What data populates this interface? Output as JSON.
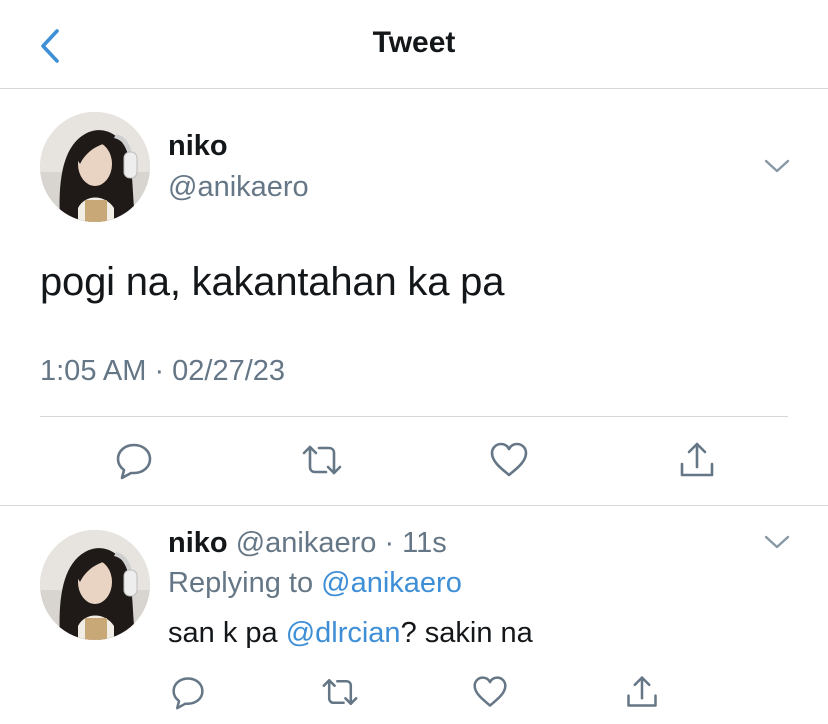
{
  "header": {
    "title": "Tweet",
    "back_icon": "chevron-left-icon",
    "accent": "#3e8fd6"
  },
  "tweet": {
    "name": "niko",
    "handle": "@anikaero",
    "text": "pogi na, kakantahan ka pa",
    "timestamp": "1:05 AM · 02/27/23",
    "menu_icon": "chevron-down-icon",
    "actions": [
      "reply-icon",
      "retweet-icon",
      "like-icon",
      "share-icon"
    ]
  },
  "reply": {
    "name": "niko",
    "handle": "@anikaero",
    "separator": "·",
    "age": "11s",
    "replying_prefix": "Replying to ",
    "replying_handle": "@anikaero",
    "text_before": "san k pa ",
    "mention": "@dlrcian",
    "text_after": "? sakin na",
    "menu_icon": "chevron-down-icon",
    "actions": [
      "reply-icon",
      "retweet-icon",
      "like-icon",
      "share-icon"
    ]
  },
  "colors": {
    "text": "#14171a",
    "secondary": "#657786",
    "link": "#3e8fd6",
    "divider": "#d6d9db"
  }
}
